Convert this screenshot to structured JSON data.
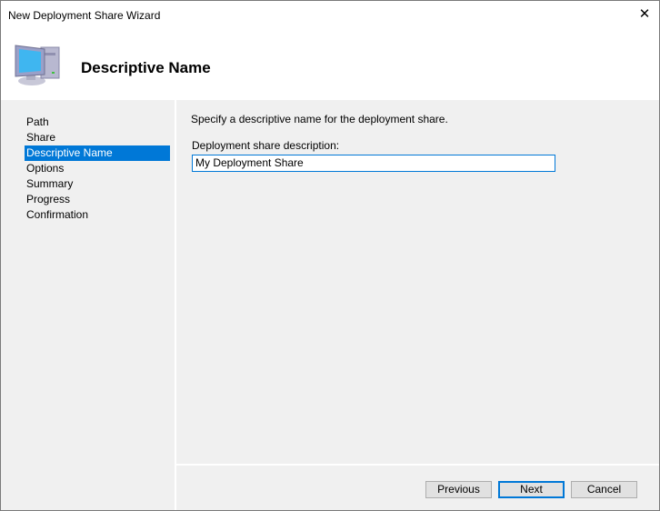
{
  "window": {
    "title": "New Deployment Share Wizard",
    "close_glyph": "✕"
  },
  "header": {
    "title": "Descriptive Name",
    "icon": "computer-icon"
  },
  "nav": {
    "items": [
      {
        "label": "Path"
      },
      {
        "label": "Share"
      },
      {
        "label": "Descriptive Name",
        "selected": true
      },
      {
        "label": "Options"
      },
      {
        "label": "Summary"
      },
      {
        "label": "Progress"
      },
      {
        "label": "Confirmation"
      }
    ]
  },
  "main": {
    "instruction": "Specify a descriptive name for the deployment share.",
    "field_label": "Deployment share description:",
    "field_value": "My Deployment Share"
  },
  "buttons": {
    "previous": "Previous",
    "next": "Next",
    "cancel": "Cancel"
  },
  "colors": {
    "accent": "#0078d7"
  }
}
